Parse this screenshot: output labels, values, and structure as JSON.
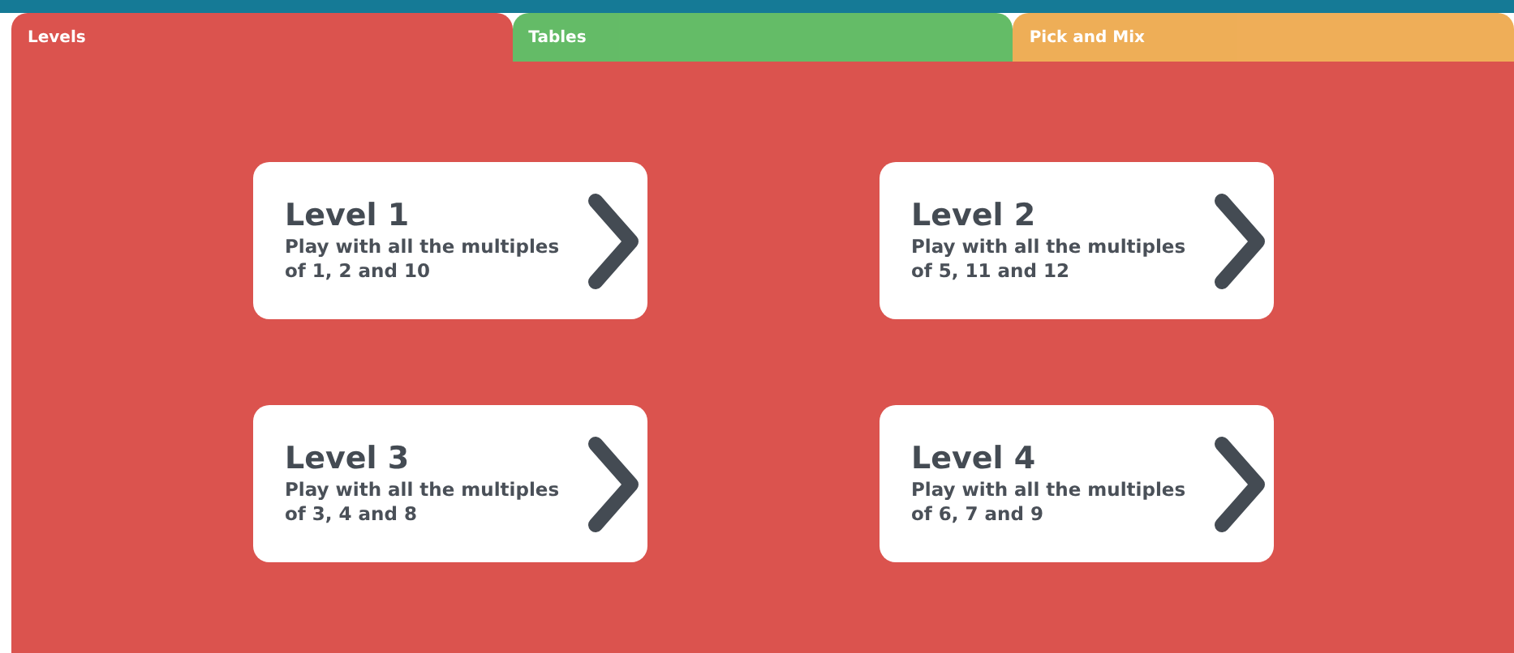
{
  "tabs": [
    {
      "label": "Levels",
      "selected": true,
      "color": "#db534e"
    },
    {
      "label": "Tables",
      "selected": false,
      "color": "#5cb85f"
    },
    {
      "label": "Pick and Mix",
      "selected": false,
      "color": "#eeaa4f"
    }
  ],
  "levels": [
    {
      "title": "Level 1",
      "description": "Play with all the multiples of 1, 2 and 10"
    },
    {
      "title": "Level 2",
      "description": "Play with all the multiples of 5, 11 and 12"
    },
    {
      "title": "Level 3",
      "description": "Play with all the multiples of 3, 4 and 8"
    },
    {
      "title": "Level 4",
      "description": "Play with all the multiples of 6, 7 and 9"
    }
  ]
}
